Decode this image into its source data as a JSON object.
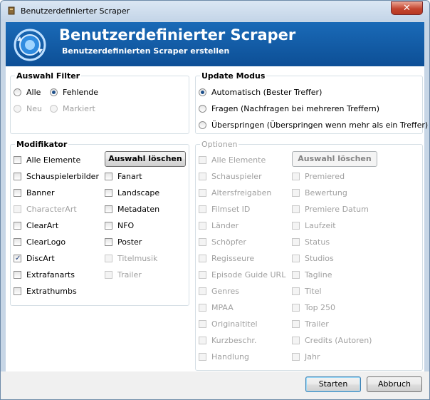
{
  "window": {
    "title": "Benutzerdefinierter Scraper"
  },
  "header": {
    "title": "Benutzerdefinierter Scraper",
    "subtitle": "Benutzerdefinierten Scraper erstellen"
  },
  "filter": {
    "legend": "Auswahl Filter",
    "items": [
      {
        "label": "Alle",
        "checked": false,
        "enabled": true
      },
      {
        "label": "Fehlende",
        "checked": true,
        "enabled": true
      },
      {
        "label": "Neu",
        "checked": false,
        "enabled": false
      },
      {
        "label": "Markiert",
        "checked": false,
        "enabled": false
      }
    ]
  },
  "update": {
    "legend": "Update Modus",
    "items": [
      {
        "label": "Automatisch (Bester Treffer)",
        "checked": true,
        "enabled": true
      },
      {
        "label": "Fragen (Nachfragen bei mehreren Treffern)",
        "checked": false,
        "enabled": true
      },
      {
        "label": "Überspringen (Überspringen wenn mehr als ein Treffer)",
        "checked": false,
        "enabled": true
      }
    ]
  },
  "modifier": {
    "legend": "Modifikator",
    "all_label": "Alle Elemente",
    "clear_label": "Auswahl löschen",
    "col1": [
      {
        "label": "Schauspielerbilder",
        "checked": false,
        "enabled": true
      },
      {
        "label": "Banner",
        "checked": false,
        "enabled": true
      },
      {
        "label": "CharacterArt",
        "checked": false,
        "enabled": false
      },
      {
        "label": "ClearArt",
        "checked": false,
        "enabled": true
      },
      {
        "label": "ClearLogo",
        "checked": false,
        "enabled": true
      },
      {
        "label": "DiscArt",
        "checked": true,
        "enabled": true
      },
      {
        "label": "Extrafanarts",
        "checked": false,
        "enabled": true
      },
      {
        "label": "Extrathumbs",
        "checked": false,
        "enabled": true
      }
    ],
    "col2": [
      {
        "label": "Fanart",
        "checked": false,
        "enabled": true
      },
      {
        "label": "Landscape",
        "checked": false,
        "enabled": true
      },
      {
        "label": "Metadaten",
        "checked": false,
        "enabled": true
      },
      {
        "label": "NFO",
        "checked": false,
        "enabled": true
      },
      {
        "label": "Poster",
        "checked": false,
        "enabled": true
      },
      {
        "label": "Titelmusik",
        "checked": false,
        "enabled": false
      },
      {
        "label": "Trailer",
        "checked": false,
        "enabled": false
      }
    ]
  },
  "options": {
    "legend": "Optionen",
    "all_label": "Alle Elemente",
    "clear_label": "Auswahl löschen",
    "col1": [
      "Schauspieler",
      "Altersfreigaben",
      "Filmset ID",
      "Länder",
      "Schöpfer",
      "Regisseure",
      "Episode Guide URL",
      "Genres",
      "MPAA",
      "Originaltitel",
      "Kurzbeschr.",
      "Handlung"
    ],
    "col2": [
      "Premiered",
      "Bewertung",
      "Premiere Datum",
      "Laufzeit",
      "Status",
      "Studios",
      "Tagline",
      "Titel",
      "Top 250",
      "Trailer",
      "Credits (Autoren)",
      "Jahr"
    ]
  },
  "footer": {
    "start_label": "Starten",
    "cancel_label": "Abbruch"
  },
  "colors": {
    "header_bg": "#1a6ab7",
    "close_bg": "#c4452f",
    "check_mark": "#1f3f7a"
  }
}
